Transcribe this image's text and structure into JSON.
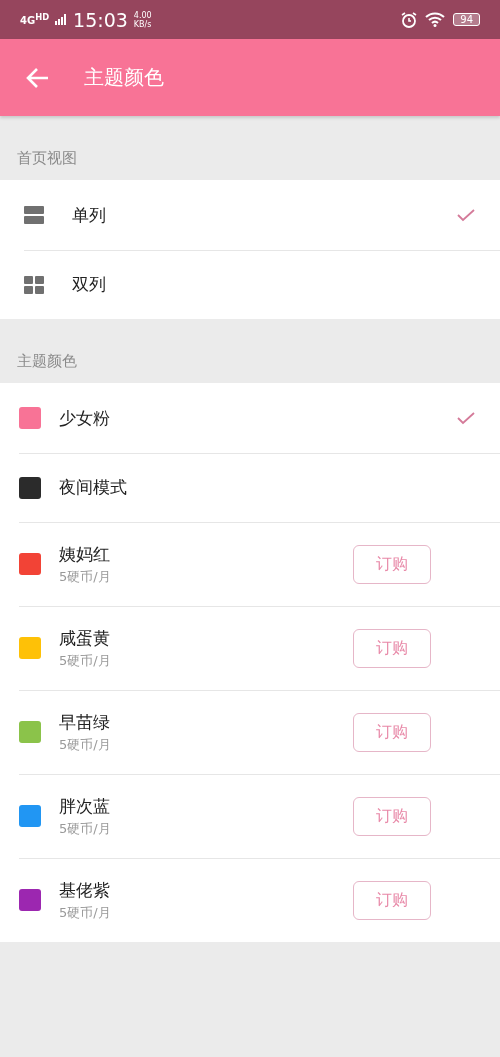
{
  "status_bar": {
    "network": "4G",
    "network_badge": "HD",
    "time": "15:03",
    "speed": "4.00",
    "speed_unit": "KB/s",
    "battery": "94"
  },
  "app_bar": {
    "title": "主题颜色"
  },
  "view_section": {
    "title": "首页视图",
    "items": [
      {
        "kind": "single",
        "label": "单列",
        "selected": true
      },
      {
        "kind": "double",
        "label": "双列",
        "selected": false
      }
    ]
  },
  "theme_section": {
    "title": "主题颜色",
    "items": [
      {
        "kind": "free",
        "name": "少女粉",
        "color": "#f87396",
        "selected": true
      },
      {
        "kind": "free",
        "name": "夜间模式",
        "color": "#2b2b2b",
        "selected": false
      },
      {
        "kind": "paid",
        "name": "姨妈红",
        "color": "#f24336",
        "selected": false,
        "price": "5硬币/月",
        "button": "订购"
      },
      {
        "kind": "paid",
        "name": "咸蛋黄",
        "color": "#fec107",
        "selected": false,
        "price": "5硬币/月",
        "button": "订购"
      },
      {
        "kind": "paid",
        "name": "早苗绿",
        "color": "#8bc34a",
        "selected": false,
        "price": "5硬币/月",
        "button": "订购"
      },
      {
        "kind": "paid",
        "name": "胖次蓝",
        "color": "#2196f3",
        "selected": false,
        "price": "5硬币/月",
        "button": "订购"
      },
      {
        "kind": "paid",
        "name": "基佬紫",
        "color": "#9c27b0",
        "selected": false,
        "price": "5硬币/月",
        "button": "订购"
      }
    ]
  }
}
